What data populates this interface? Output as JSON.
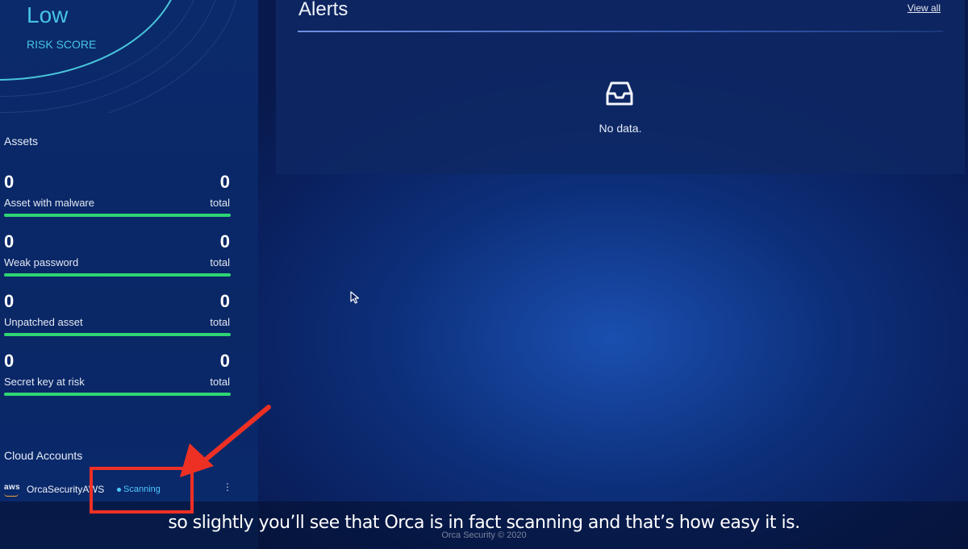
{
  "risk_score": {
    "value": "Low",
    "label": "RISK SCORE"
  },
  "assets": {
    "title": "Assets",
    "total_label": "total",
    "items": [
      {
        "label": "Asset with malware",
        "count": "0",
        "total": "0"
      },
      {
        "label": "Weak password",
        "count": "0",
        "total": "0"
      },
      {
        "label": "Unpatched asset",
        "count": "0",
        "total": "0"
      },
      {
        "label": "Secret key at risk",
        "count": "0",
        "total": "0"
      }
    ]
  },
  "cloud_accounts": {
    "title": "Cloud Accounts",
    "items": [
      {
        "provider_icon": "aws",
        "name": "OrcaSecurityAWS",
        "status": "Scanning",
        "menu_icon": "⋮"
      }
    ]
  },
  "alerts": {
    "title": "Alerts",
    "view_all": "View all",
    "empty_text": "No data."
  },
  "footer": {
    "copyright": "Orca Security © 2020"
  },
  "caption": {
    "text": "so slightly you’ll see that Orca is in fact scanning and that’s how easy it is."
  },
  "colors": {
    "accent": "#46c4e6",
    "bar_fill": "#2ed573",
    "annotation": "#ee3024"
  }
}
